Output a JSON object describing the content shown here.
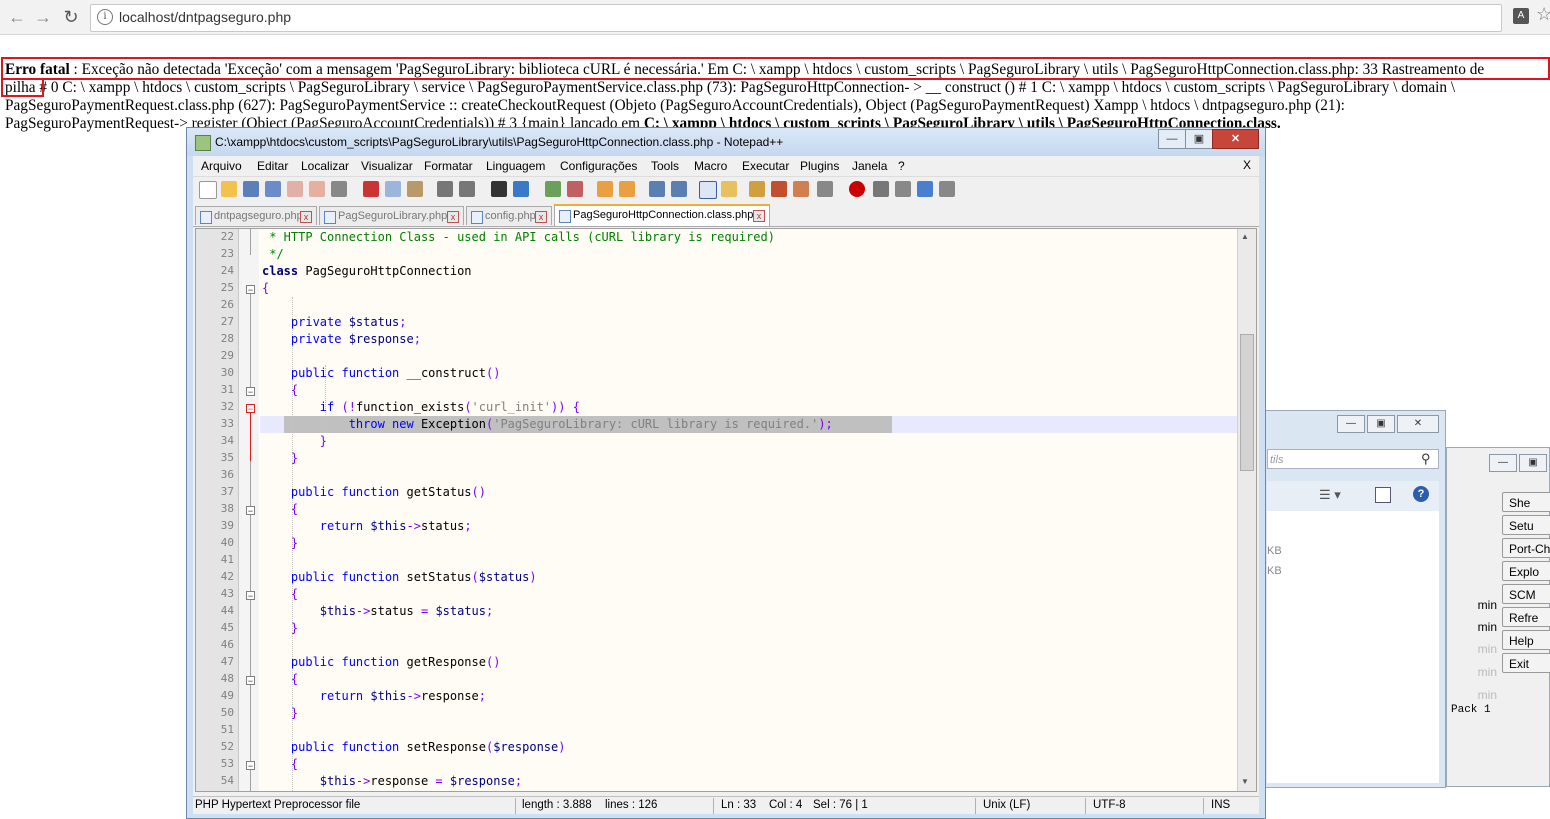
{
  "browser": {
    "url": "localhost/dntpagseguro.php"
  },
  "error": {
    "label": "Erro fatal",
    "line1_rest": " : Exceção não detectada 'Exceção' com a mensagem 'PagSeguroLibrary: biblioteca cURL é necessária.' Em C: \\ xampp \\ htdocs \\ custom_scripts \\ PagSeguroLibrary \\ utils \\ PagSeguroHttpConnection.class.php: 33 Rastreamento de",
    "line2_word": "pilha",
    "line2_rest": " # 0 C: \\ xampp \\ htdocs \\ custom_scripts \\ PagSeguroLibrary \\ service \\ PagSeguroPaymentService.class.php (73): PagSeguroHttpConnection- > __ construct () # 1 C: \\ xampp \\ htdocs \\ custom_scripts \\ PagSeguroLibrary \\ domain \\",
    "line3": "PagSeguroPaymentRequest.class.php (627): PagSeguroPaymentService :: createCheckoutRequest (Objeto (PagSeguroAccountCredentials), Object (PagSeguroPaymentRequest) Xampp \\ htdocs \\ dntpagseguro.php (21):",
    "line4_a": "PagSeguroPaymentRequest-> register (Object (PagSeguroAccountCredentials)) # 3 {main} lançado em ",
    "line4_b": "C: \\ xampp \\ htdocs \\ custom_scripts \\ PagSeguroLibrary \\ utils \\ PagSeguroHttpConnection.class."
  },
  "npp": {
    "title": "C:\\xampp\\htdocs\\custom_scripts\\PagSeguroLibrary\\utils\\PagSeguroHttpConnection.class.php - Notepad++",
    "menu": [
      "Arquivo",
      "Editar",
      "Localizar",
      "Visualizar",
      "Formatar",
      "Linguagem",
      "Configurações",
      "Tools",
      "Macro",
      "Executar",
      "Plugins",
      "Janela",
      "?"
    ],
    "menu_close": "X",
    "tabs": [
      {
        "label": "dntpagseguro.php",
        "active": false
      },
      {
        "label": "PagSeguroLibrary.php",
        "active": false
      },
      {
        "label": "config.php",
        "active": false
      },
      {
        "label": "PagSeguroHttpConnection.class.php",
        "active": true
      }
    ],
    "line_numbers": [
      "22",
      "23",
      "24",
      "25",
      "26",
      "27",
      "28",
      "29",
      "30",
      "31",
      "32",
      "33",
      "34",
      "35",
      "36",
      "37",
      "38",
      "39",
      "40",
      "41",
      "42",
      "43",
      "44",
      "45",
      "46",
      "47",
      "48",
      "49",
      "50",
      "51",
      "52",
      "53",
      "54"
    ],
    "code": {
      "l22": " * HTTP Connection Class - used in API calls (cURL library is required)",
      "l23": " */",
      "l24_kw": "class",
      "l24_name": " PagSeguroHttpConnection",
      "l25": "{",
      "l27_kw": "private",
      "l27_var": " $status",
      "l28_kw": "private",
      "l28_var": " $response",
      "l30_kw": "public function",
      "l30_fn": " __construct",
      "l32_kw": "if",
      "l32_fn": "function_exists",
      "l32_str": "'curl_init'",
      "l33_kw": "throw new",
      "l33_fn": " Exception",
      "l33_str": "'PagSeguroLibrary: cURL library is required.'",
      "l37_fn": " getStatus",
      "l39_kw": "return",
      "l39_var": " $this",
      "l39_prop": "status",
      "l42_fn": " setStatus",
      "l42_var": "$status",
      "l44_var": "$this",
      "l44_prop": "status",
      "l44_rhs": "$status",
      "l47_fn": " getResponse",
      "l49_prop": "response",
      "l52_fn": " setResponse",
      "l52_var": "$response",
      "l54_prop": "response",
      "l54_rhs": "$response"
    },
    "status": {
      "type": "PHP Hypertext Preprocessor file",
      "length": "length : 3.888",
      "lines": "lines : 126",
      "ln": "Ln : 33",
      "col": "Col : 4",
      "sel": "Sel : 76 | 1",
      "eol": "Unix (LF)",
      "enc": "UTF-8",
      "ins": "INS"
    }
  },
  "bg_explorer": {
    "search_placeholder": "tils",
    "sizes": [
      "KB",
      "KB"
    ]
  },
  "bg_panel": {
    "buttons": [
      "She",
      "Setu",
      "Port-Ch",
      "Explo",
      "SCM",
      "Refre",
      "Help",
      "Exit"
    ],
    "admin": [
      "min",
      "min",
      "min",
      "min",
      "min"
    ],
    "pack": "Pack 1"
  }
}
